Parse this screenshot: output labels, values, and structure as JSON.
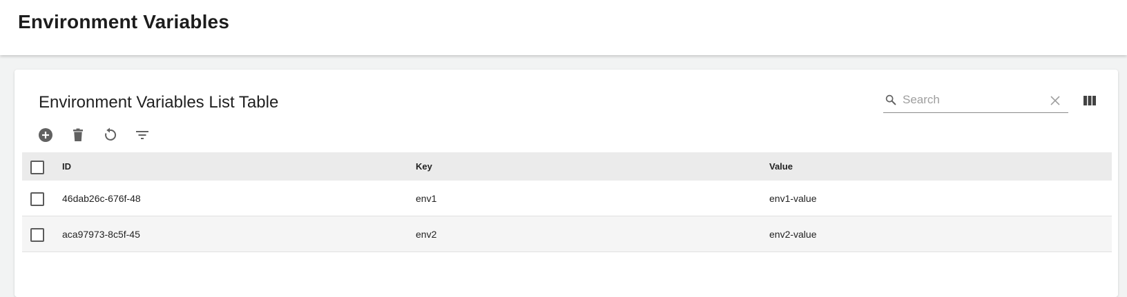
{
  "app_bar": {
    "title": "Environment Variables"
  },
  "card": {
    "title": "Environment Variables List Table",
    "search": {
      "placeholder": "Search",
      "value": ""
    },
    "toolbar": {
      "actions": [
        {
          "name": "add",
          "icon": "add-circle-icon"
        },
        {
          "name": "delete",
          "icon": "trash-icon"
        },
        {
          "name": "refresh",
          "icon": "refresh-icon"
        },
        {
          "name": "filter",
          "icon": "filter-icon"
        }
      ]
    },
    "table": {
      "columns": [
        "ID",
        "Key",
        "Value"
      ],
      "rows": [
        {
          "id": "46dab26c-676f-48",
          "key": "env1",
          "value": "env1-value"
        },
        {
          "id": "aca97973-8c5f-45",
          "key": "env2",
          "value": "env2-value"
        }
      ]
    }
  },
  "colors": {
    "icon": "#616161",
    "header_bg": "#ebebeb",
    "page_bg": "#f2f3f3"
  }
}
